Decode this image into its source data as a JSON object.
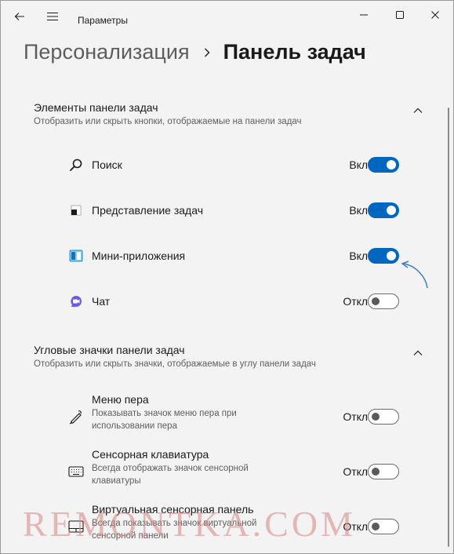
{
  "window": {
    "title": "Параметры",
    "accent_color": "#0067c0"
  },
  "icons": {
    "back": "arrow-left-icon",
    "menu": "hamburger-menu-icon",
    "minimize": "minimize-icon",
    "maximize": "maximize-icon",
    "close": "close-icon"
  },
  "breadcrumb": {
    "parent": "Персонализация",
    "current": "Панель задач"
  },
  "sections": [
    {
      "title": "Элементы панели задач",
      "subtitle": "Отобразить или скрыть кнопки, отображаемые на панели задач",
      "expanded": true,
      "items": [
        {
          "icon": "search-icon",
          "label": "Поиск",
          "state": "Вкл.",
          "on": true
        },
        {
          "icon": "task-view-icon",
          "label": "Представление задач",
          "state": "Вкл.",
          "on": true
        },
        {
          "icon": "widgets-icon",
          "label": "Мини-приложения",
          "state": "Вкл.",
          "on": true
        },
        {
          "icon": "chat-icon",
          "label": "Чат",
          "state": "Откл.",
          "on": false
        }
      ]
    },
    {
      "title": "Угловые значки панели задач",
      "subtitle": "Отобразить или скрыть значки, отображаемые в углу панели задач",
      "expanded": true,
      "items": [
        {
          "icon": "pen-icon",
          "label": "Меню пера",
          "description": "Показывать значок меню пера при использовании пера",
          "state": "Откл.",
          "on": false
        },
        {
          "icon": "keyboard-icon",
          "label": "Сенсорная клавиатура",
          "description": "Всегда отображать значок сенсорной клавиатуры",
          "state": "Откл.",
          "on": false
        },
        {
          "icon": "touchpad-icon",
          "label": "Виртуальная сенсорная панель",
          "description": "Всегда показывать значок виртуальной сенсорной панели",
          "state": "Откл.",
          "on": false
        }
      ]
    }
  ],
  "watermark": "REMONTKA.COM"
}
